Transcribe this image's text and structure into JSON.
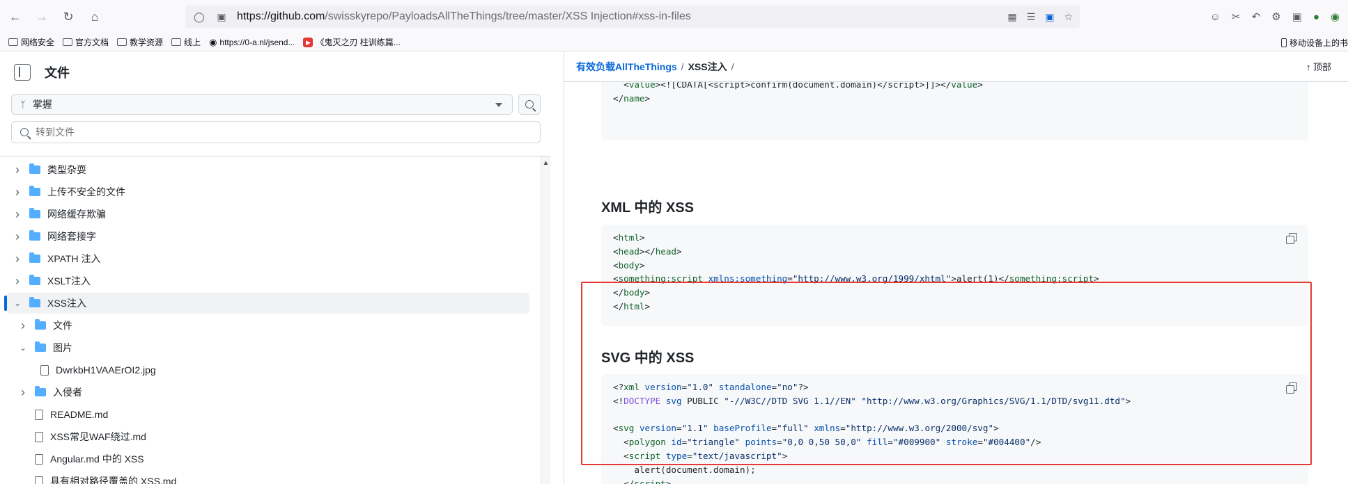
{
  "browser": {
    "url_host": "https://github.com",
    "url_path": "/swisskyrepo/PayloadsAllTheThings/tree/master/XSS Injection#xss-in-files",
    "bookmarks": [
      "网络安全",
      "官方文档",
      "教学资源",
      "线上",
      "https://0-a.nl/jsend...",
      "《鬼灭之刃 柱训练篇..."
    ],
    "mobile_bookmarks": "移动设备上的书"
  },
  "sidebar": {
    "title": "文件",
    "branch": "掌握",
    "goto_placeholder": "转到文件",
    "tree": [
      {
        "label": "类型杂耍",
        "kind": "folder",
        "level": 0,
        "expanded": false
      },
      {
        "label": "上传不安全的文件",
        "kind": "folder",
        "level": 0,
        "expanded": false
      },
      {
        "label": "网络缓存欺骗",
        "kind": "folder",
        "level": 0,
        "expanded": false
      },
      {
        "label": "网络套接字",
        "kind": "folder",
        "level": 0,
        "expanded": false
      },
      {
        "label": "XPATH 注入",
        "kind": "folder",
        "level": 0,
        "expanded": false
      },
      {
        "label": "XSLT注入",
        "kind": "folder",
        "level": 0,
        "expanded": false
      },
      {
        "label": "XSS注入",
        "kind": "folder",
        "level": 0,
        "expanded": true,
        "active": true
      },
      {
        "label": "文件",
        "kind": "folder",
        "level": 1,
        "expanded": false
      },
      {
        "label": "图片",
        "kind": "folder",
        "level": 1,
        "expanded": true
      },
      {
        "label": "DwrkbH1VAAErOI2.jpg",
        "kind": "file",
        "level": 2
      },
      {
        "label": "入侵者",
        "kind": "folder",
        "level": 1,
        "expanded": false
      },
      {
        "label": "README.md",
        "kind": "file",
        "level": 1
      },
      {
        "label": "XSS常见WAF绕过.md",
        "kind": "file",
        "level": 1
      },
      {
        "label": "Angular.md 中的 XSS",
        "kind": "file",
        "level": 1
      },
      {
        "label": "具有相对路径覆盖的 XSS.md",
        "kind": "file",
        "level": 1
      }
    ]
  },
  "breadcrumb": {
    "repo": "有效负载AllTheThings",
    "sep": "/",
    "current": "XSS注入",
    "trail": "/",
    "top_button": "顶部"
  },
  "content": {
    "heading_xml": "XML 中的 XSS",
    "heading_svg": "SVG 中的 XSS"
  }
}
